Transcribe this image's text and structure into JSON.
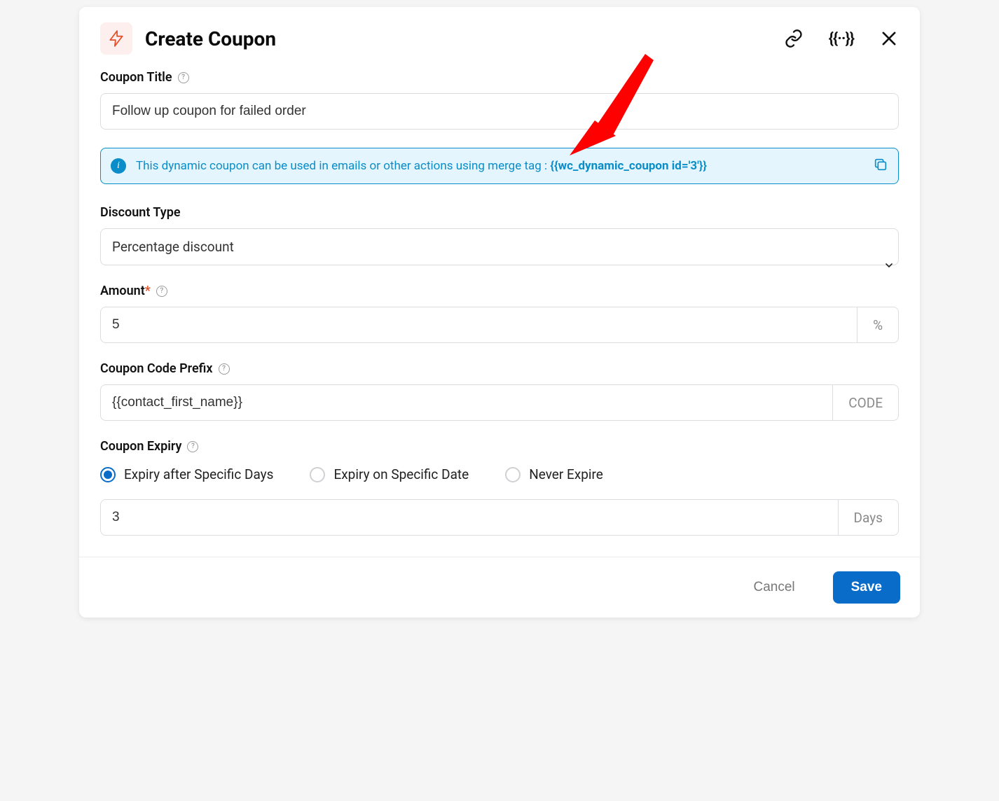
{
  "header": {
    "title": "Create Coupon"
  },
  "form": {
    "coupon_title": {
      "label": "Coupon Title",
      "value": "Follow up coupon for failed order"
    },
    "info_banner": {
      "text_prefix": "This dynamic coupon can be used in emails or other actions using merge tag : ",
      "merge_tag": "{{wc_dynamic_coupon id='3'}}"
    },
    "discount_type": {
      "label": "Discount Type",
      "selected": "Percentage discount"
    },
    "amount": {
      "label": "Amount",
      "required_mark": "*",
      "value": "5",
      "suffix": "%"
    },
    "coupon_prefix": {
      "label": "Coupon Code Prefix",
      "value": "{{contact_first_name}}",
      "suffix": "CODE"
    },
    "expiry": {
      "label": "Coupon Expiry",
      "options": {
        "specific_days": "Expiry after Specific Days",
        "specific_date": "Expiry on Specific Date",
        "never": "Never Expire"
      },
      "days_value": "3",
      "days_suffix": "Days"
    }
  },
  "footer": {
    "cancel": "Cancel",
    "save": "Save"
  }
}
